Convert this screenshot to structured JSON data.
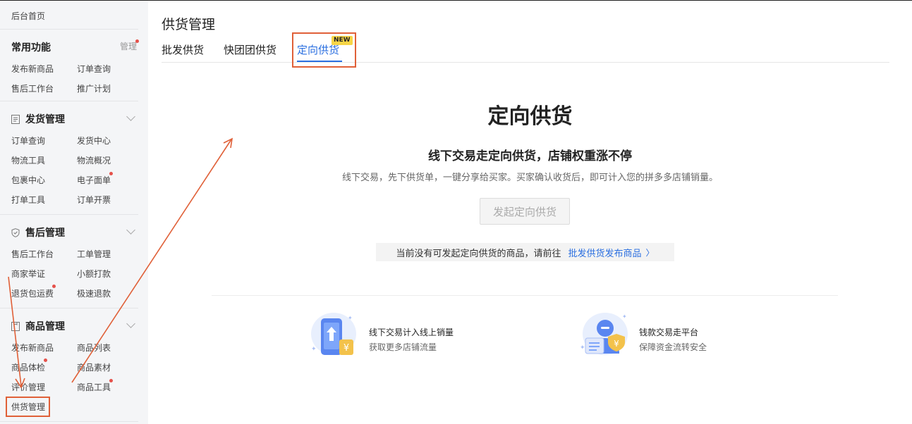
{
  "sidebar": {
    "home": "后台首页",
    "common": {
      "title": "常用功能",
      "manage": "管理",
      "items": [
        "发布新商品",
        "订单查询",
        "售后工作台",
        "推广计划"
      ]
    },
    "shipping": {
      "title": "发货管理",
      "items": [
        "订单查询",
        "发货中心",
        "物流工具",
        "物流概况",
        "包裹中心",
        "电子面单",
        "打单工具",
        "订单开票"
      ]
    },
    "aftersale": {
      "title": "售后管理",
      "items": [
        "售后工作台",
        "工单管理",
        "商家举证",
        "小额打款",
        "退货包运费",
        "极速退款"
      ]
    },
    "goods": {
      "title": "商品管理",
      "items": [
        "发布新商品",
        "商品列表",
        "商品体检",
        "商品素材",
        "评价管理",
        "商品工具",
        "供货管理"
      ]
    }
  },
  "main": {
    "page_title": "供货管理",
    "tabs": [
      {
        "label": "批发供货"
      },
      {
        "label": "快团团供货"
      },
      {
        "label": "定向供货",
        "badge": "NEW"
      }
    ],
    "hero": {
      "title": "定向供货",
      "subtitle": "线下交易走定向供货，店铺权重涨不停",
      "desc": "线下交易，先下供货单，一键分享给买家。买家确认收货后，即可计入您的拼多多店铺销量。",
      "button": "发起定向供货"
    },
    "notice": {
      "text": "当前没有可发起定向供货的商品，请前往",
      "link": "批发供货发布商品",
      "arrow": "〉"
    },
    "features": [
      {
        "title": "线下交易计入线上销量",
        "desc": "获取更多店铺流量",
        "icon": "phone-upload-icon"
      },
      {
        "title": "钱款交易走平台",
        "desc": "保障资金流转安全",
        "icon": "secure-payment-icon"
      }
    ]
  },
  "colors": {
    "accent": "#2b6fe0",
    "annotation": "#e06038",
    "badge": "#f7d546",
    "dot": "#e5514a"
  }
}
